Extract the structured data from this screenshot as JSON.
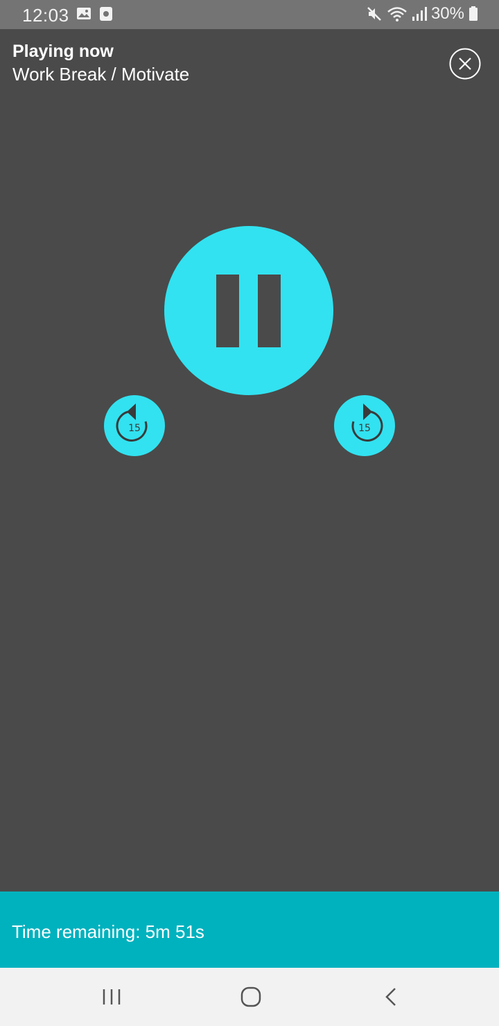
{
  "status_bar": {
    "time": "12:03",
    "battery": "30%",
    "icons": [
      "image-icon",
      "media-icon",
      "mute-icon",
      "wifi-icon",
      "signal-icon",
      "battery-icon"
    ]
  },
  "header": {
    "label": "Playing now",
    "title": "Work Break / Motivate",
    "close_icon": "close-circle-icon"
  },
  "player": {
    "state_icon": "pause-icon",
    "skip_back_label": "15",
    "skip_forward_label": "15",
    "accent_color": "#32e2f0"
  },
  "footer": {
    "time_remaining": "Time remaining: 5m 51s",
    "color": "#00b2be"
  },
  "nav": {
    "icons": [
      "recent-apps-icon",
      "home-icon",
      "back-icon"
    ]
  },
  "colors": {
    "background": "#4a4a4a",
    "status_bar": "#747474"
  }
}
